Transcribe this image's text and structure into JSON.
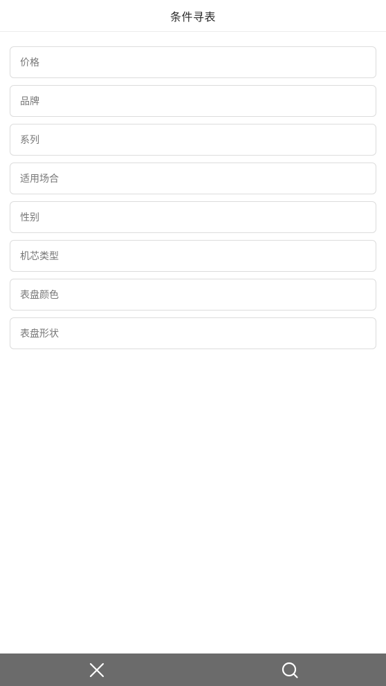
{
  "header": {
    "title": "条件寻表"
  },
  "filters": [
    {
      "label": "价格"
    },
    {
      "label": "品牌"
    },
    {
      "label": "系列"
    },
    {
      "label": "适用场合"
    },
    {
      "label": "性别"
    },
    {
      "label": "机芯类型"
    },
    {
      "label": "表盘颜色"
    },
    {
      "label": "表盘形状"
    }
  ],
  "bottom_bar": {
    "close_icon": "close-icon",
    "search_icon": "search-icon",
    "background": "#6b6b6b",
    "icon_color": "#ffffff"
  }
}
